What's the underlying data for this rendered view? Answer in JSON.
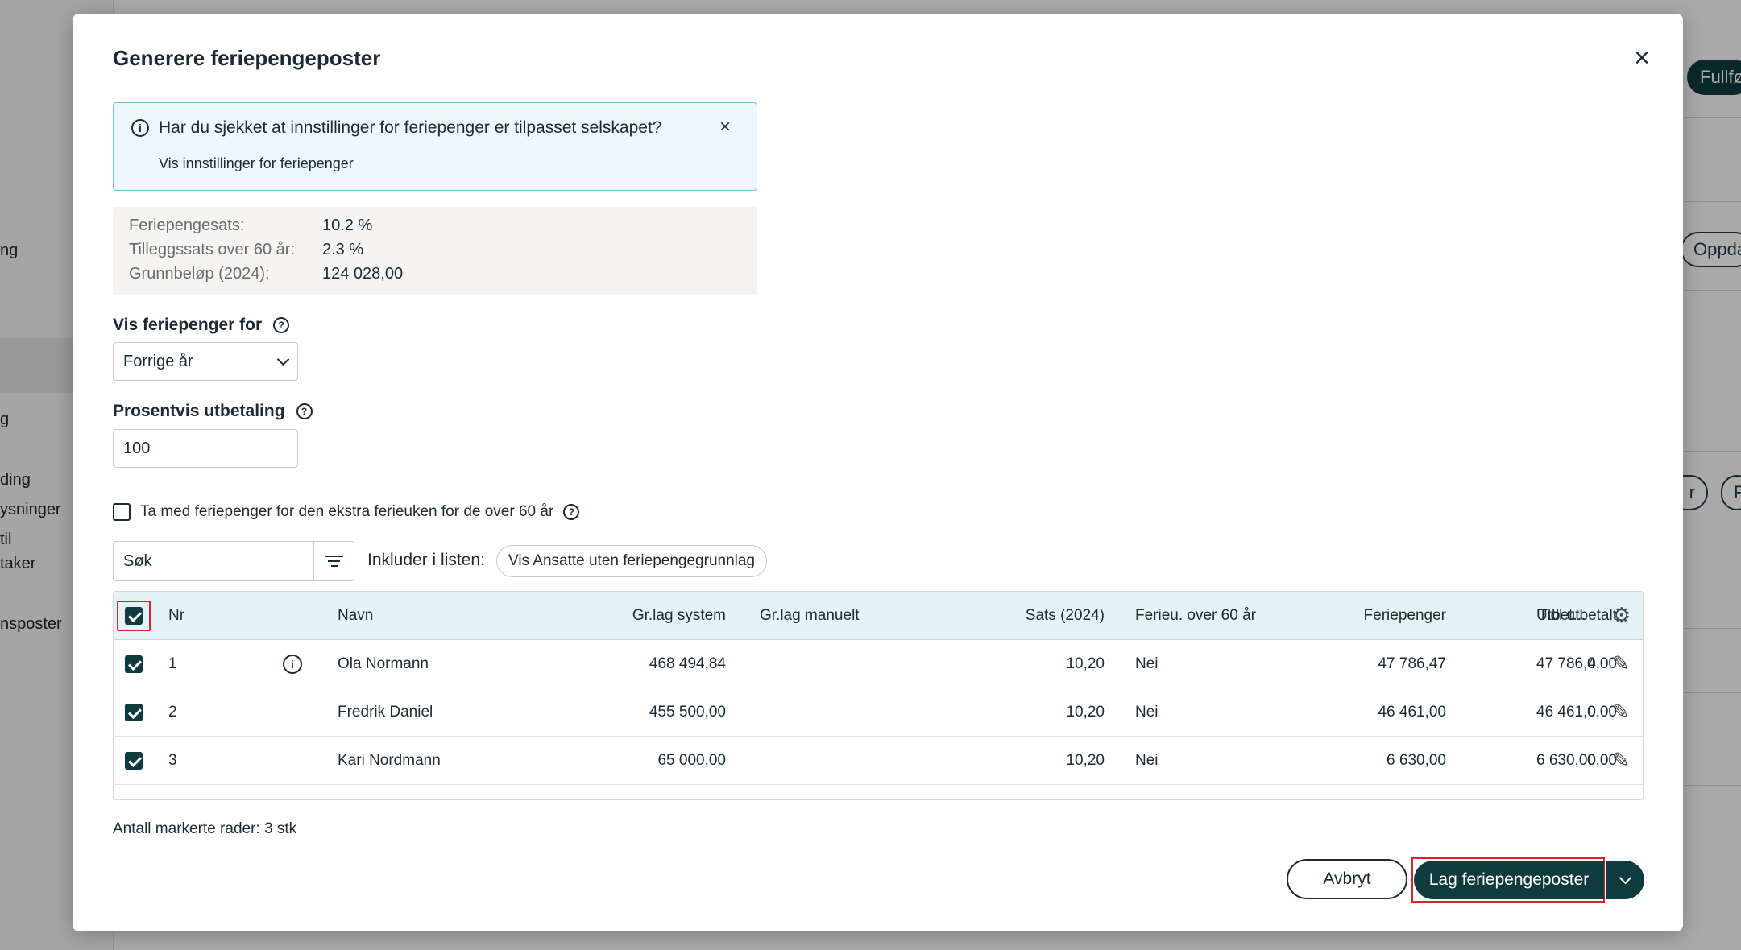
{
  "background": {
    "sidebar_fragments": [
      "ng",
      "g",
      "ding",
      "ysninger",
      "til",
      "taker",
      "nsposter"
    ],
    "right_buttons": [
      "Fullfø",
      "Oppda",
      "r",
      "F"
    ]
  },
  "modal": {
    "title": "Generere feriepengeposter",
    "close_icon": "close-icon"
  },
  "info_banner": {
    "text": "Har du sjekket at innstillinger for feriepenger er tilpasset selskapet?",
    "link": "Vis innstillinger for feriepenger"
  },
  "rates": [
    {
      "label": "Feriepengesats:",
      "value": "10.2 %"
    },
    {
      "label": "Tilleggssats over 60 år:",
      "value": "2.3 %"
    },
    {
      "label": "Grunnbeløp (2024):",
      "value": "124 028,00"
    }
  ],
  "show_for": {
    "label": "Vis feriepenger for",
    "selected": "Forrige år"
  },
  "percent_payout": {
    "label": "Prosentvis utbetaling",
    "value": "100"
  },
  "extra_week": {
    "label": "Ta med feriepenger for den ekstra ferieuken for de over 60 år",
    "checked": false
  },
  "search": {
    "placeholder": "Søk"
  },
  "include": {
    "label": "Inkluder i listen:",
    "chip": "Vis Ansatte uten feriepengegrunnlag"
  },
  "table": {
    "headers": {
      "nr": "Nr",
      "name": "Navn",
      "base_system": "Gr.lag system",
      "base_manual": "Gr.lag manuelt",
      "rate": "Sats (2024)",
      "over60": "Ferieu. over 60 år",
      "holiday_pay": "Feriepenger",
      "prev_paid": "Tidl utbetalt",
      "payout": "Utbet..."
    },
    "rows": [
      {
        "nr": "1",
        "name": "Ola Normann",
        "base_system": "468 494,84",
        "base_manual": "",
        "rate": "10,20",
        "over60": "Nei",
        "holiday_pay": "47 786,47",
        "prev_paid": "0,00",
        "payout": "47 786,4",
        "has_info": true
      },
      {
        "nr": "2",
        "name": "Fredrik Daniel",
        "base_system": "455 500,00",
        "base_manual": "",
        "rate": "10,20",
        "over60": "Nei",
        "holiday_pay": "46 461,00",
        "prev_paid": "0,00",
        "payout": "46 461,0",
        "has_info": false
      },
      {
        "nr": "3",
        "name": "Kari Nordmann",
        "base_system": "65 000,00",
        "base_manual": "",
        "rate": "10,20",
        "over60": "Nei",
        "holiday_pay": "6 630,00",
        "prev_paid": "0,00",
        "payout": "6 630,00",
        "has_info": false
      }
    ]
  },
  "selected_count": {
    "label": "Antall markerte rader:",
    "value": "3 stk"
  },
  "footer": {
    "cancel": "Avbryt",
    "primary": "Lag feriepengeposter"
  },
  "colors": {
    "primary": "#0f3b3f",
    "info_bg": "#eef8fa",
    "info_border": "#6fc3d1",
    "focus_ring": "#d6252d"
  }
}
